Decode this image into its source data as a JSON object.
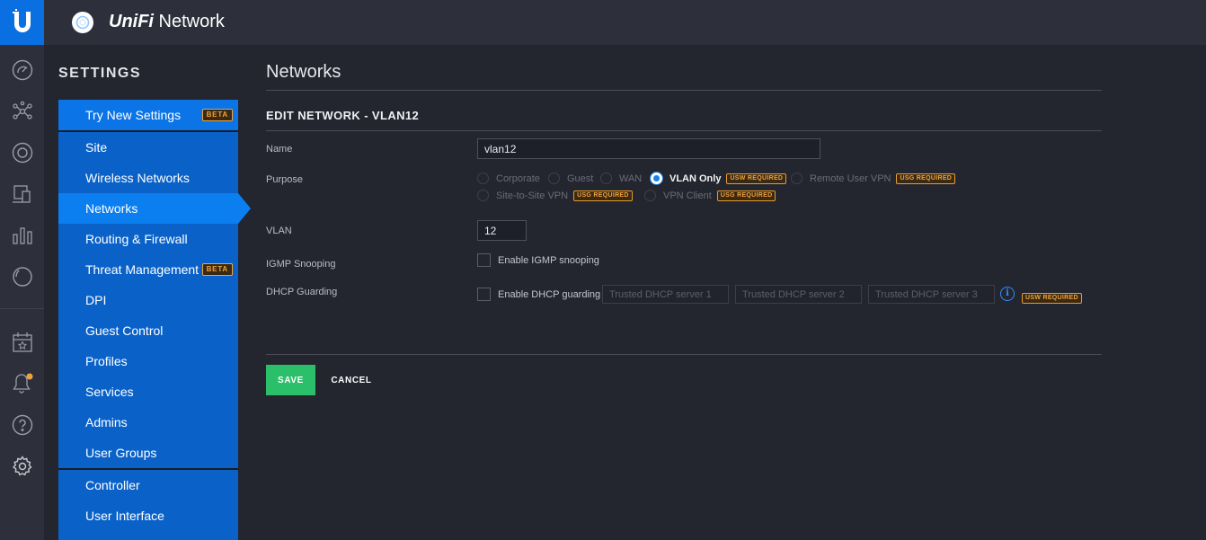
{
  "app": {
    "brand_prefix": "UniFi",
    "brand_suffix": " Network"
  },
  "rail": {
    "icons": [
      "dashboard-icon",
      "topology-icon",
      "devices-icon",
      "clients-icon",
      "statistics-icon",
      "insights-icon",
      "events-icon",
      "alerts-icon",
      "help-icon",
      "settings-icon"
    ],
    "alert_dot_color": "#f0a23a"
  },
  "sidebar": {
    "title": "SETTINGS",
    "try_new": {
      "label": "Try New Settings",
      "badge": "BETA"
    },
    "items": [
      {
        "label": "Site"
      },
      {
        "label": "Wireless Networks"
      },
      {
        "label": "Networks",
        "active": true
      },
      {
        "label": "Routing & Firewall"
      },
      {
        "label": "Threat Management",
        "badge": "BETA"
      },
      {
        "label": "DPI"
      },
      {
        "label": "Guest Control"
      },
      {
        "label": "Profiles"
      },
      {
        "label": "Services"
      },
      {
        "label": "Admins"
      },
      {
        "label": "User Groups"
      }
    ],
    "footer_items": [
      {
        "label": "Controller"
      },
      {
        "label": "User Interface"
      }
    ]
  },
  "main": {
    "page_title": "Networks",
    "section_title": "EDIT NETWORK - VLAN12",
    "name": {
      "label": "Name",
      "value": "vlan12"
    },
    "purpose": {
      "label": "Purpose",
      "options": [
        {
          "label": "Corporate",
          "selected": false
        },
        {
          "label": "Guest",
          "selected": false
        },
        {
          "label": "WAN",
          "selected": false
        },
        {
          "label": "VLAN Only",
          "selected": true,
          "badge": "USW REQUIRED"
        },
        {
          "label": "Remote User VPN",
          "selected": false,
          "badge": "USG REQUIRED"
        },
        {
          "label": "Site-to-Site VPN",
          "selected": false,
          "badge": "USG REQUIRED"
        },
        {
          "label": "VPN Client",
          "selected": false,
          "badge": "USG REQUIRED"
        }
      ]
    },
    "vlan": {
      "label": "VLAN",
      "value": "12"
    },
    "igmp": {
      "label": "IGMP Snooping",
      "checkbox_label": "Enable IGMP snooping",
      "checked": false
    },
    "dhcp_guarding": {
      "label": "DHCP Guarding",
      "checkbox_label": "Enable DHCP guarding",
      "checked": false,
      "server_placeholders": [
        "Trusted DHCP server 1",
        "Trusted DHCP server 2",
        "Trusted DHCP server 3"
      ],
      "badge": "USW REQUIRED"
    },
    "save_label": "SAVE",
    "cancel_label": "CANCEL"
  },
  "colors": {
    "accent": "#0b7ef0",
    "nav": "#0a62c9",
    "save": "#2cbf6a",
    "warning_badge": "#f0a23a"
  }
}
